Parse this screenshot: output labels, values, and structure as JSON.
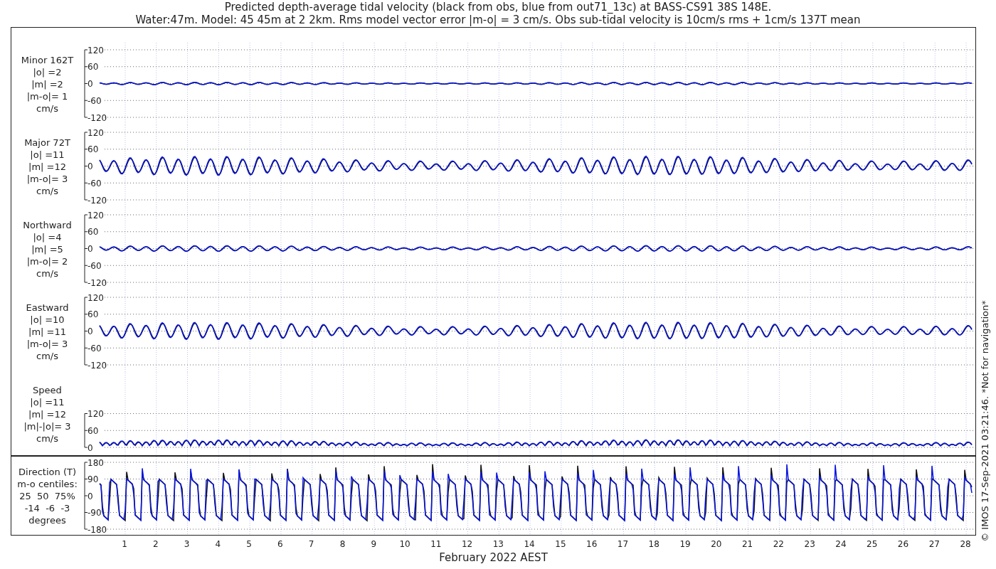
{
  "title_lines": [
    "Predicted depth-average tidal velocity (black from obs, blue from out71_13c) at BASS-CS91 38S 148E.",
    "Water:47m. Model: 45 45m at 2 2km. Rms model vector error |m-o| = 3 cm/s. Obs sub-tidal velocity is 10cm/s rms + 1cm/s 137T mean"
  ],
  "panels": [
    {
      "kind": "velocity",
      "label_lines": [
        "Minor 162T",
        "|o| =2",
        "|m| =2",
        "|m-o|= 1",
        "cm/s"
      ],
      "yticks": [
        "120",
        "60",
        "0",
        "-60",
        "-120"
      ]
    },
    {
      "kind": "velocity",
      "label_lines": [
        "Major 72T",
        "|o| =11",
        "|m| =12",
        "|m-o|= 3",
        "cm/s"
      ],
      "yticks": [
        "120",
        "60",
        "0",
        "-60",
        "-120"
      ]
    },
    {
      "kind": "velocity",
      "label_lines": [
        "Northward",
        "|o| =4",
        "|m| =5",
        "|m-o|= 2",
        "cm/s"
      ],
      "yticks": [
        "120",
        "60",
        "0",
        "-60",
        "-120"
      ]
    },
    {
      "kind": "velocity",
      "label_lines": [
        "Eastward",
        "|o| =10",
        "|m| =11",
        "|m-o|= 3",
        "cm/s"
      ],
      "yticks": [
        "120",
        "60",
        "0",
        "-60",
        "-120"
      ]
    },
    {
      "kind": "speed",
      "label_lines": [
        "Speed",
        "|o| =11",
        "|m| =12",
        "|m|-|o|= 3",
        "cm/s"
      ],
      "yticks": [
        "120",
        "60",
        "0"
      ]
    },
    {
      "kind": "direction",
      "label_lines": [
        "Direction (T)",
        "m-o centiles:",
        "25  50  75%",
        "-14  -6  -3",
        "degrees"
      ],
      "yticks": [
        "180",
        "90",
        "0",
        "-90",
        "-180"
      ]
    }
  ],
  "xticks": [
    "1",
    "2",
    "3",
    "4",
    "5",
    "6",
    "7",
    "8",
    "9",
    "10",
    "11",
    "12",
    "13",
    "14",
    "15",
    "16",
    "17",
    "18",
    "19",
    "20",
    "21",
    "22",
    "23",
    "24",
    "25",
    "26",
    "27",
    "28"
  ],
  "xlabel": "February 2022 AEST",
  "credit": "© IMOS 17-Sep-2021 03:21:46. *Not for navigation*"
}
